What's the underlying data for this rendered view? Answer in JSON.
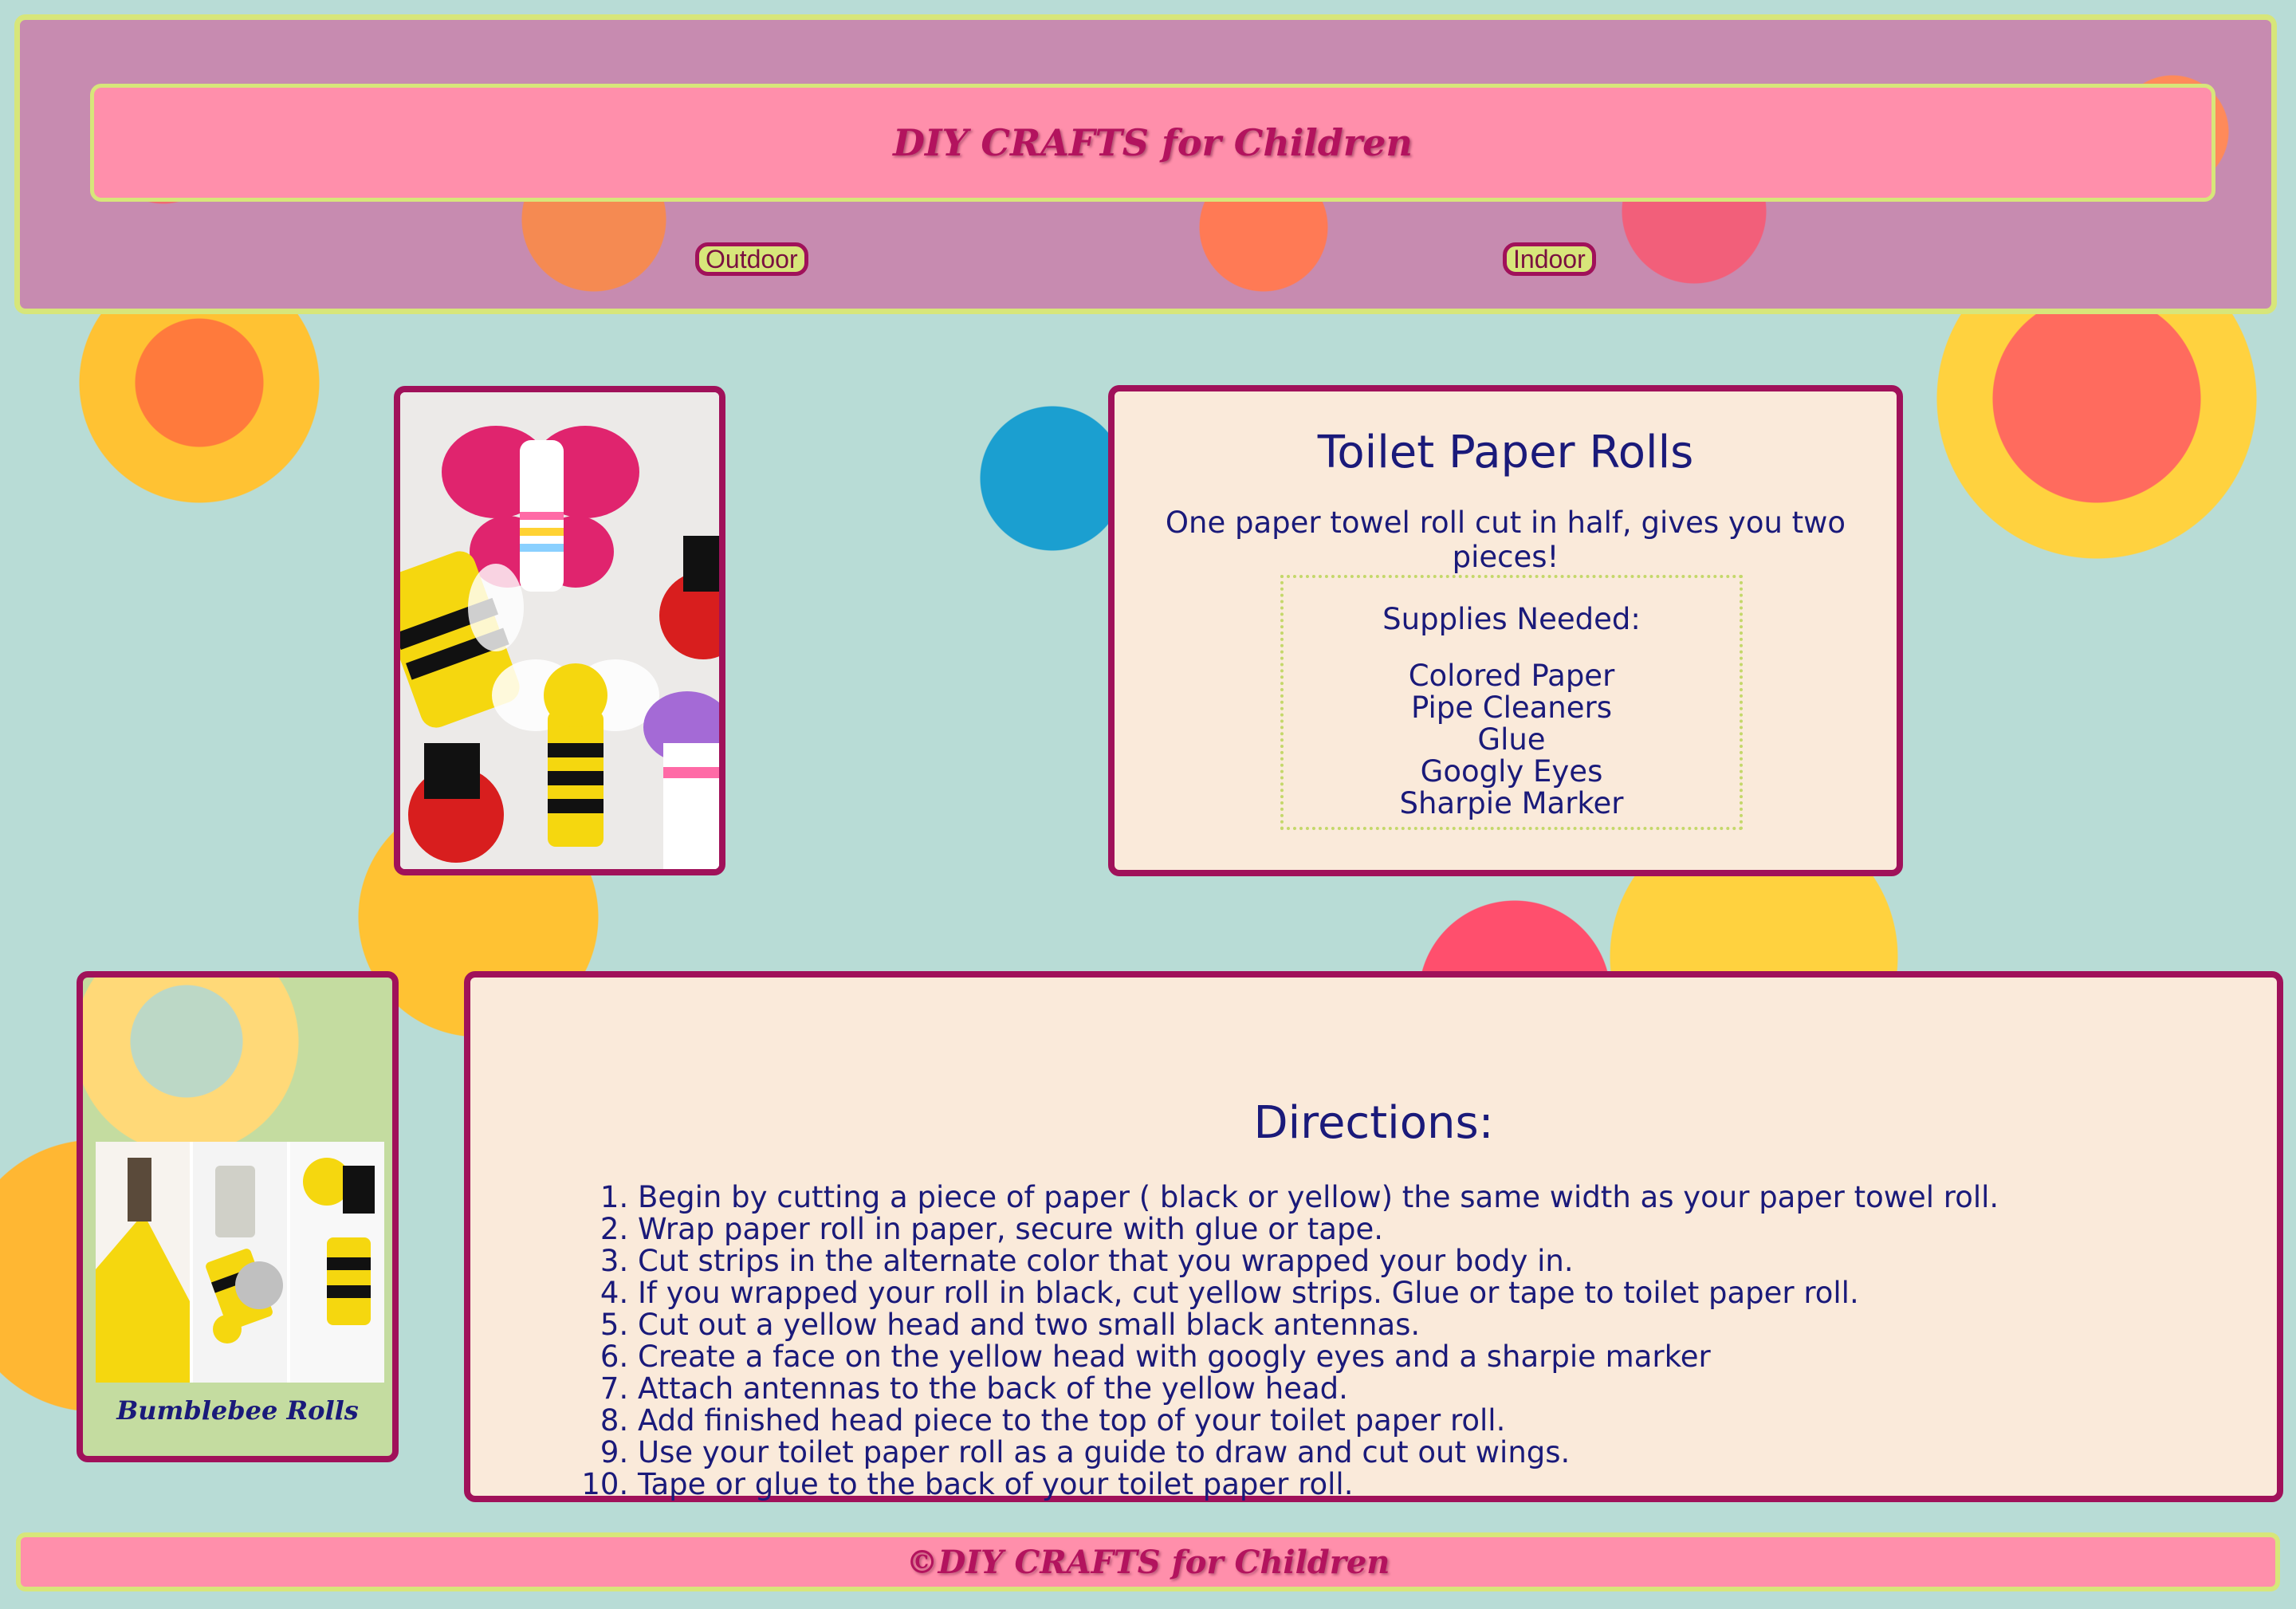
{
  "header": {
    "title": "DIY CRAFTS for Children",
    "nav": [
      {
        "label": "Outdoor"
      },
      {
        "label": "Indoor"
      }
    ]
  },
  "craft": {
    "title": "Toilet Paper Rolls",
    "subtitle": "One paper towel roll cut in half, gives you two pieces!",
    "supplies_heading": "Supplies Needed:",
    "supplies": [
      "Colored Paper",
      "Pipe Cleaners",
      "Glue",
      "Googly Eyes",
      "Sharpie Marker"
    ]
  },
  "example": {
    "caption": "Bumblebee Rolls"
  },
  "directions": {
    "heading": "Directions:",
    "steps": [
      "Begin by cutting a piece of paper ( black or yellow) the same width as your paper towel roll.",
      "Wrap paper roll in paper, secure with glue or tape.",
      "Cut strips in the alternate color that you wrapped your body in.",
      "If you wrapped your roll in black, cut yellow strips. Glue or tape to toilet paper roll.",
      "Cut out a yellow head and two small black antennas.",
      "Create a face on the yellow head with googly eyes and a sharpie marker",
      "Attach antennas to the back of the yellow head.",
      "Add finished head piece to the top of your toilet paper roll.",
      "Use your toilet paper roll as a guide to draw and cut out wings.",
      "Tape or glue to the back of your toilet paper roll."
    ]
  },
  "footer": {
    "text": "©DIY CRAFTS for Children"
  },
  "colors": {
    "accent": "#a0115a",
    "border_green": "#d7e67a",
    "pink": "#ff8fab",
    "card_bg": "#faeada",
    "text_navy": "#1a1a7a"
  }
}
